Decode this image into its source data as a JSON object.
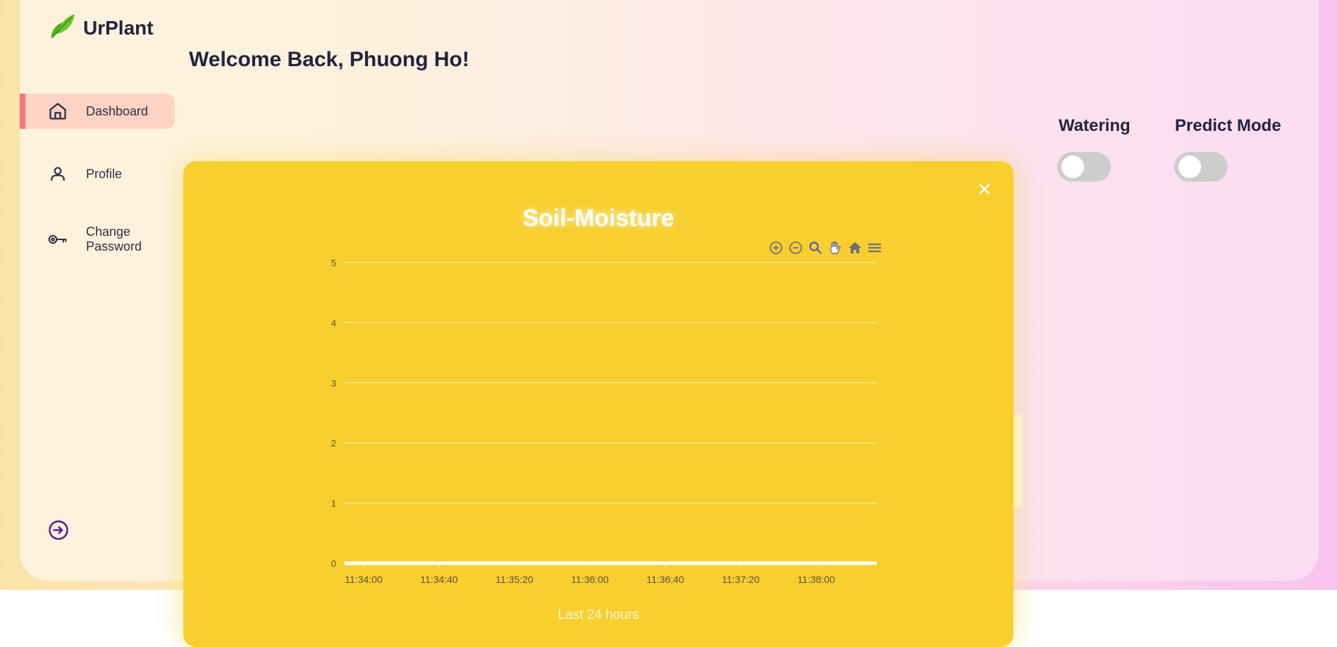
{
  "app": {
    "name": "UrPlant"
  },
  "header": {
    "welcome": "Welcome Back, Phuong Ho!"
  },
  "sidebar": {
    "items": [
      {
        "label": "Dashboard",
        "icon": "home-icon",
        "active": true
      },
      {
        "label": "Profile",
        "icon": "user-icon",
        "active": false
      },
      {
        "label": "Change Password",
        "icon": "key-icon",
        "active": false
      }
    ],
    "logout_icon": "logout-icon"
  },
  "controls": {
    "watering": {
      "label": "Watering",
      "on": false
    },
    "predict": {
      "label": "Predict Mode",
      "on": false
    }
  },
  "modal": {
    "title": "Soil-Moisture",
    "footer": "Last 24 hours",
    "toolbar": [
      "zoom-in-icon",
      "zoom-out-icon",
      "magnify-icon",
      "pan-hand-icon",
      "reset-home-icon",
      "menu-icon"
    ]
  },
  "colors": {
    "modal_bg": "#f8cf2f",
    "active_nav": "#fdd3c3",
    "active_bar": "#f5767b",
    "text_dark": "#23233f"
  },
  "chart_data": {
    "type": "line",
    "title": "Soil-Moisture",
    "x_ticks": [
      "11:34:00",
      "11:34:40",
      "11:35:20",
      "11:36:00",
      "11:36:40",
      "11:37:20",
      "11:38:00"
    ],
    "y_ticks": [
      0,
      1,
      2,
      3,
      4,
      5
    ],
    "ylim": [
      0,
      5
    ],
    "grid": true,
    "series": [
      {
        "values": [
          0,
          0,
          0,
          0,
          0,
          0,
          0
        ]
      }
    ]
  }
}
